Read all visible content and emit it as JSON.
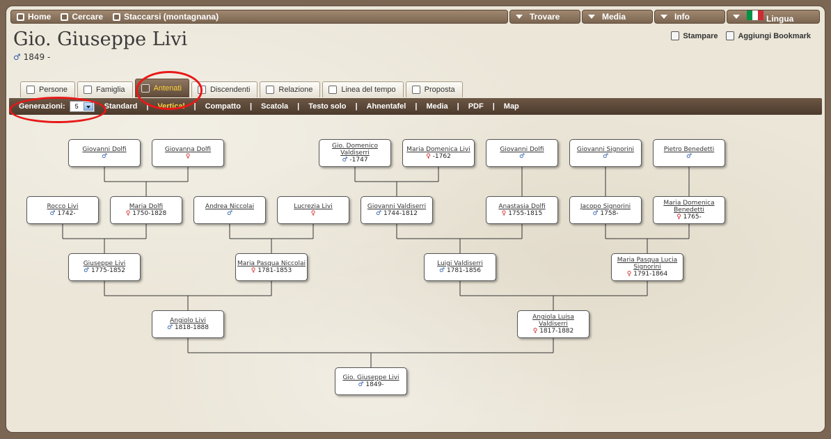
{
  "topbar": {
    "home": "Home",
    "search": "Cercare",
    "logout": "Staccarsi (montagnana)",
    "menus": [
      "Trovare",
      "Media",
      "Info"
    ],
    "language": "Lingua",
    "flag_colors": [
      "#009246",
      "#ffffff",
      "#ce2b37"
    ]
  },
  "person": {
    "name": "Gio. Giuseppe Livi",
    "sex_symbol": "♂",
    "birth": "1849 -"
  },
  "actions": {
    "print": "Stampare",
    "bookmark": "Aggiungi Bookmark"
  },
  "tabs": [
    "Persone",
    "Famiglia",
    "Antenati",
    "Discendenti",
    "Relazione",
    "Linea del tempo",
    "Proposta"
  ],
  "active_tab": "Antenati",
  "generations": {
    "label": "Generazioni:",
    "value": "5"
  },
  "views": [
    "Standard",
    "Vertical",
    "Compatto",
    "Scatola",
    "Testo solo",
    "Ahnentafel",
    "Media",
    "PDF",
    "Map"
  ],
  "active_view": "Vertical",
  "colors": {
    "male": "#2b5aa8",
    "female": "#cc2222",
    "highlight": "#e81818",
    "accent": "#ffd23a"
  },
  "tree": [
    {
      "id": "p1",
      "name": "Gio. Giuseppe Livi",
      "sex": "♂",
      "dates": "1849-"
    },
    {
      "id": "p2",
      "name": "Angiolo Livi",
      "sex": "♂",
      "dates": "1818-1888"
    },
    {
      "id": "p3",
      "name": "Angiola Luisa Valdiserri",
      "sex": "♀",
      "dates": "1817-1882"
    },
    {
      "id": "p4",
      "name": "Giuseppe Livi",
      "sex": "♂",
      "dates": "1775-1852"
    },
    {
      "id": "p5",
      "name": "Maria Pasqua Niccolai",
      "sex": "♀",
      "dates": "1781-1853"
    },
    {
      "id": "p6",
      "name": "Luigi Valdiserri",
      "sex": "♂",
      "dates": "1781-1856"
    },
    {
      "id": "p7",
      "name": "Maria Pasqua Lucia Signorini",
      "sex": "♀",
      "dates": "1791-1864"
    },
    {
      "id": "p8",
      "name": "Rocco Livi",
      "sex": "♂",
      "dates": "1742-"
    },
    {
      "id": "p9",
      "name": "Maria Dolfi",
      "sex": "♀",
      "dates": "1750-1828"
    },
    {
      "id": "p10",
      "name": "Andrea Niccolai",
      "sex": "♂",
      "dates": ""
    },
    {
      "id": "p11",
      "name": "Lucrezia Livi",
      "sex": "♀",
      "dates": ""
    },
    {
      "id": "p12",
      "name": "Giovanni Valdiserri",
      "sex": "♂",
      "dates": "1744-1812"
    },
    {
      "id": "p13",
      "name": "Anastasia Dolfi",
      "sex": "♀",
      "dates": "1755-1815"
    },
    {
      "id": "p14",
      "name": "Jacopo Signorini",
      "sex": "♂",
      "dates": "1758-"
    },
    {
      "id": "p15",
      "name": "Maria Domenica Benedetti",
      "sex": "♀",
      "dates": "1765-"
    },
    {
      "id": "p18",
      "name": "Giovanni Dolfi",
      "sex": "♂",
      "dates": ""
    },
    {
      "id": "p19",
      "name": "Giovanna Dolfi",
      "sex": "♀",
      "dates": ""
    },
    {
      "id": "p24",
      "name": "Gio. Domenico Valdiserri",
      "sex": "♂",
      "dates": "-1747"
    },
    {
      "id": "p25",
      "name": "Maria Domenica Livi",
      "sex": "♀",
      "dates": "-1762"
    },
    {
      "id": "p26",
      "name": "Giovanni Dolfi",
      "sex": "♂",
      "dates": ""
    },
    {
      "id": "p28",
      "name": "Giovanni Signorini",
      "sex": "♂",
      "dates": ""
    },
    {
      "id": "p30",
      "name": "Pietro Benedetti",
      "sex": "♂",
      "dates": ""
    }
  ]
}
